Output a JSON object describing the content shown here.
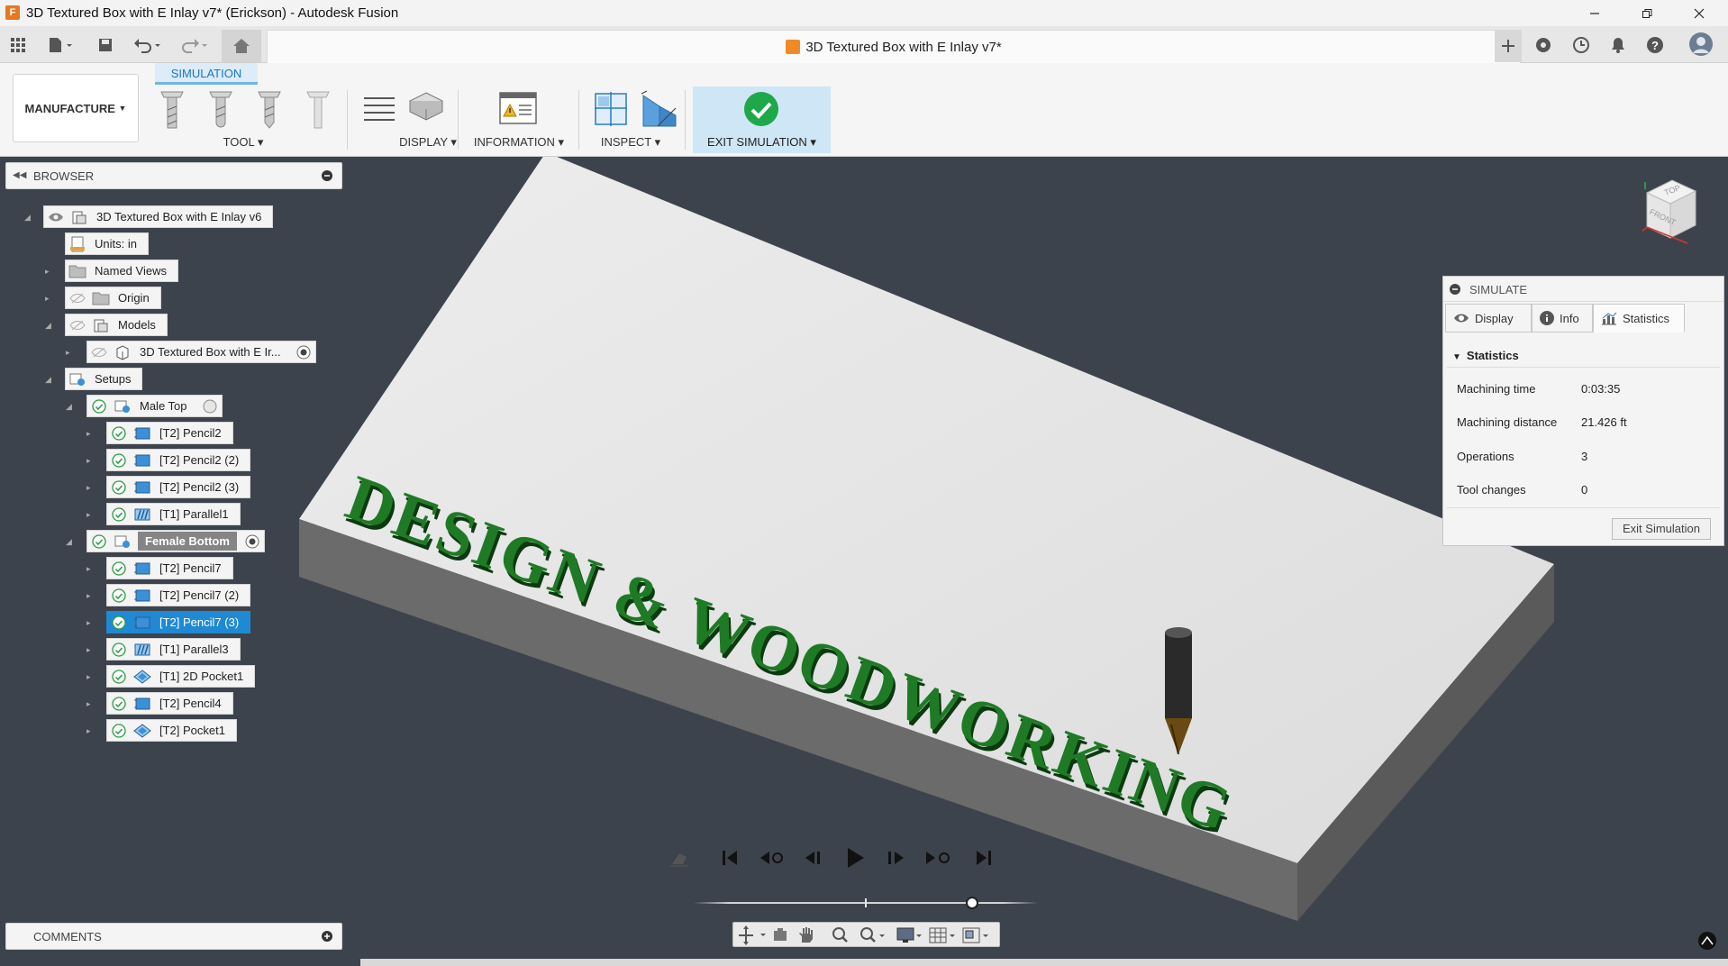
{
  "window": {
    "title": "3D Textured Box with E Inlay v7* (Erickson) - Autodesk Fusion",
    "minimize_icon": "minimize-icon",
    "restore_icon": "restore-icon",
    "close_icon": "close-icon"
  },
  "document_tab": {
    "title": "3D Textured Box with E Inlay v7*",
    "close_icon": "close-icon"
  },
  "ribbon": {
    "workspace": "MANUFACTURE",
    "active_tab": "SIMULATION",
    "groups": {
      "tool": "TOOL",
      "display": "DISPLAY",
      "information": "INFORMATION",
      "inspect": "INSPECT",
      "exit": "EXIT SIMULATION"
    }
  },
  "browser": {
    "title": "BROWSER",
    "root": "3D Textured Box with E Inlay v6",
    "units": "Units: in",
    "named_views": "Named Views",
    "origin": "Origin",
    "models": "Models",
    "model_item": "3D Textured Box with E Ir...",
    "setups": "Setups",
    "setup1": {
      "name": "Male Top",
      "ops": [
        "[T2] Pencil2",
        "[T2] Pencil2 (2)",
        "[T2] Pencil2 (3)",
        "[T1] Parallel1"
      ]
    },
    "setup2": {
      "name": "Female Bottom",
      "ops": [
        "[T2] Pencil7",
        "[T2] Pencil7 (2)",
        "[T2] Pencil7 (3)",
        "[T1] Parallel3",
        "[T1] 2D Pocket1",
        "[T2] Pencil4",
        "[T2] Pocket1"
      ]
    }
  },
  "comments": {
    "title": "COMMENTS"
  },
  "viewcube": {
    "top": "TOP",
    "front": "FRONT"
  },
  "model_text": "DESIGN & WOODWORKING",
  "simulate": {
    "title": "SIMULATE",
    "tabs": [
      "Display",
      "Info",
      "Statistics"
    ],
    "section": "Statistics",
    "stats": [
      {
        "label": "Machining time",
        "value": "0:03:35"
      },
      {
        "label": "Machining distance",
        "value": "21.426 ft"
      },
      {
        "label": "Operations",
        "value": "3"
      },
      {
        "label": "Tool changes",
        "value": "0"
      }
    ],
    "exit_button": "Exit Simulation"
  },
  "playback": {
    "progress": 0.81
  },
  "colors": {
    "accent": "#1f8ad3",
    "inlay_green": "#1f7a26",
    "exit_check": "#1ea84a",
    "viewport_bg": "#3d434c"
  }
}
